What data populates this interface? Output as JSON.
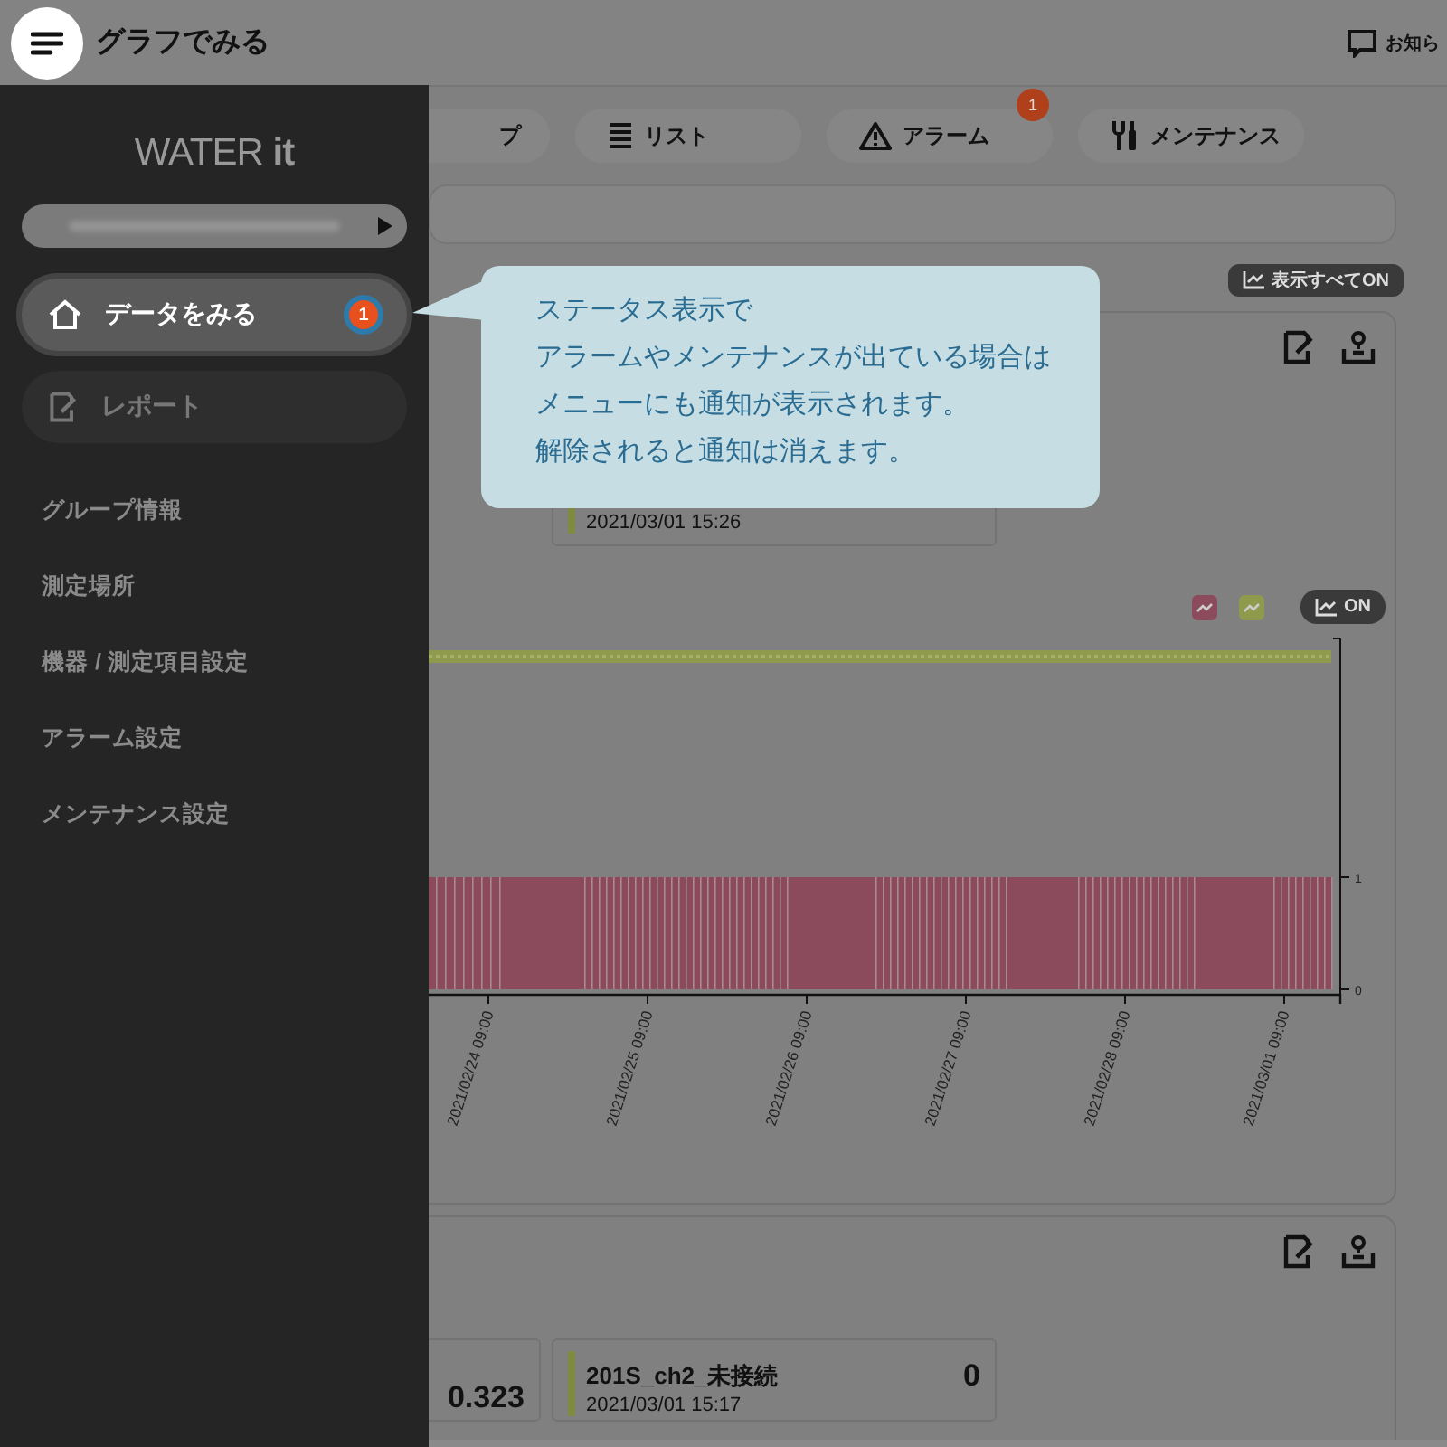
{
  "header": {
    "title": "グラフでみる",
    "notice": "お知ら"
  },
  "tabs": [
    {
      "label": "プ",
      "selected": false
    },
    {
      "label": "リスト",
      "selected": false
    },
    {
      "label": "アラーム",
      "selected": false,
      "badge": "1"
    },
    {
      "label": "メンテナンス",
      "selected": false
    }
  ],
  "show_all_button": "表示すべてON",
  "sidebar": {
    "logo": "WATER **it**",
    "nav": [
      {
        "label": "データをみる",
        "selected": true,
        "badge": "1"
      },
      {
        "label": "レポート",
        "selected": false
      }
    ],
    "links": [
      "グループ情報",
      "測定場所",
      "機器 / 測定項目設定",
      "アラーム設定",
      "メンテナンス設定"
    ]
  },
  "callout": [
    "ステータス表示で",
    "アラームやメンテナンスが出ている場合は",
    "メニューにも通知が表示されます。",
    "解除されると通知は消えます。"
  ],
  "cards": [
    {
      "readings": [
        {
          "date": "2021/03/01 15:26",
          "color": "#7f8b3e"
        }
      ],
      "chart": {
        "legend": [
          {
            "color": "#8c4b5c"
          },
          {
            "color": "#8f9a4c"
          }
        ],
        "toggle": "ON",
        "yticks": [
          "1",
          "0"
        ],
        "xticks": [
          "2021/02/24 09:00",
          "2021/02/25 09:00",
          "2021/02/26 09:00",
          "2021/02/27 09:00",
          "2021/02/28 09:00",
          "2021/03/01 09:00"
        ]
      }
    },
    {
      "readings": [
        {
          "value": "0.323"
        },
        {
          "name": "201S_ch2_未接続",
          "value": "0",
          "date": "2021/03/01 15:17",
          "color": "#7f8b3e"
        }
      ]
    }
  ]
}
